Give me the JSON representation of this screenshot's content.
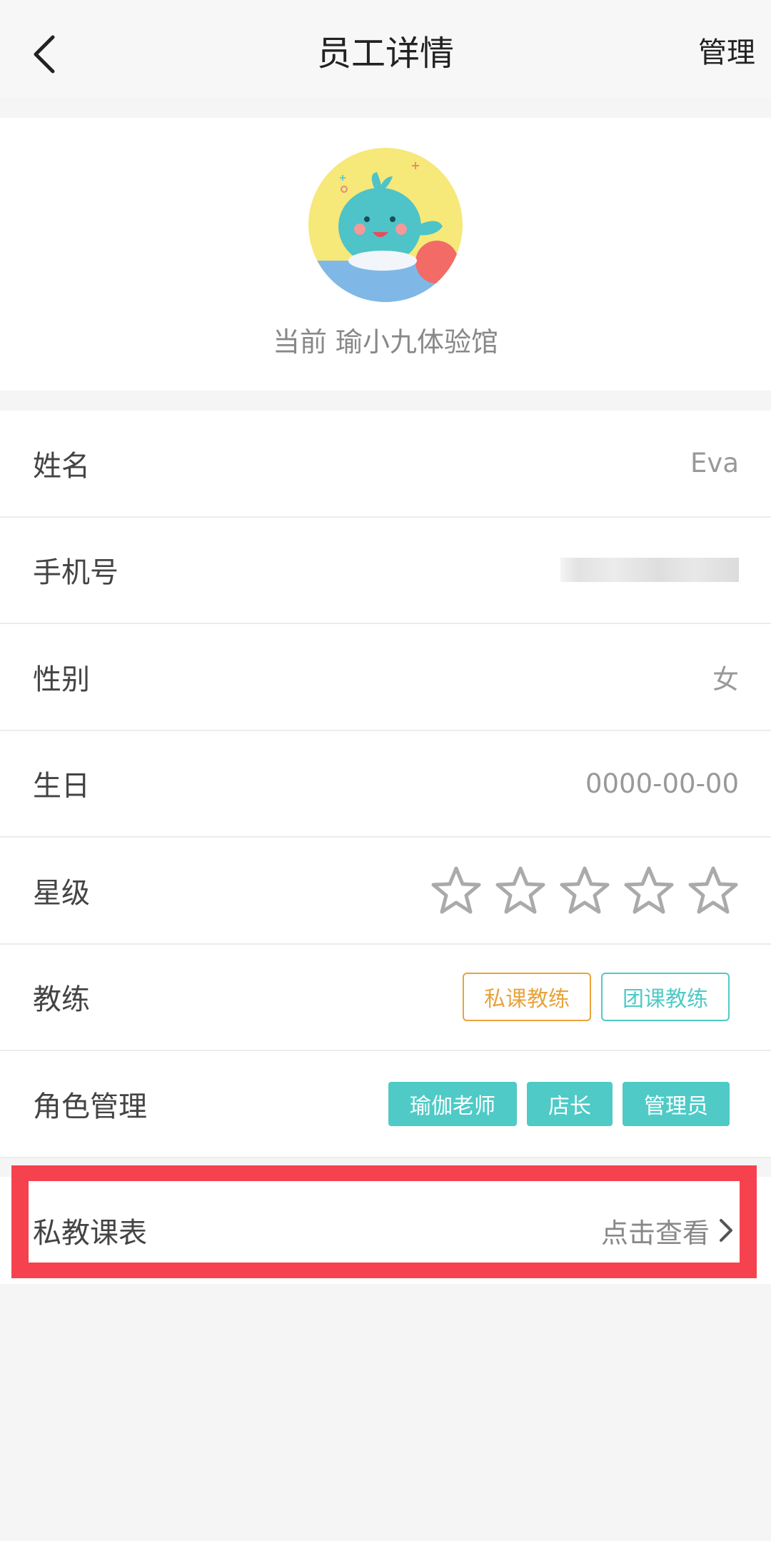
{
  "header": {
    "title": "员工详情",
    "action": "管理",
    "back_icon": "chevron-left-icon"
  },
  "profile": {
    "store_text": "当前 瑜小九体验馆",
    "avatar_icon": "whale-mascot-avatar"
  },
  "fields": {
    "name": {
      "label": "姓名",
      "value": "Eva"
    },
    "phone": {
      "label": "手机号"
    },
    "gender": {
      "label": "性别",
      "value": "女"
    },
    "birthday": {
      "label": "生日",
      "value": "0000-00-00"
    },
    "rating": {
      "label": "星级",
      "stars": 0,
      "max": 5
    },
    "coach": {
      "label": "教练",
      "tags": [
        "私课教练",
        "团课教练"
      ]
    },
    "roles": {
      "label": "角色管理",
      "tags": [
        "瑜伽老师",
        "店长",
        "管理员"
      ]
    }
  },
  "schedule": {
    "label": "私教课表",
    "link": "点击查看"
  },
  "colors": {
    "accent_teal": "#4fcac6",
    "accent_orange": "#e9a33b",
    "highlight_red": "#f5424e"
  }
}
